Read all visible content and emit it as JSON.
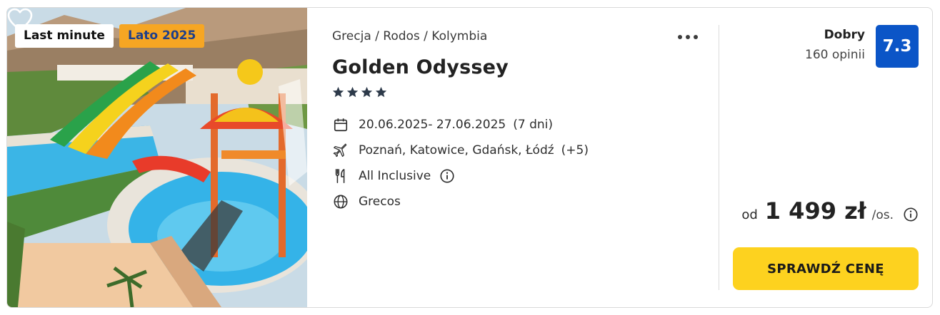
{
  "photo": {
    "alt_icon": "waterpark-photo",
    "badges": {
      "last_minute": "Last minute",
      "season": "Lato 2025"
    },
    "favorite_icon": "heart-outline-icon"
  },
  "offer": {
    "breadcrumb": "Grecja / Rodos / Kolymbia",
    "more_icon": "more-dots-icon",
    "hotel_name": "Golden Odyssey",
    "stars": 4,
    "dates": "20.06.2025- 27.06.2025",
    "duration": "(7 dni)",
    "departures": "Poznań, Katowice, Gdańsk, Łódź",
    "departures_more": "(+5)",
    "board": "All Inclusive",
    "operator": "Grecos"
  },
  "rating": {
    "label": "Dobry",
    "reviews": "160 opinii",
    "score": "7.3",
    "color": "#0b55c7"
  },
  "price": {
    "prefix": "od",
    "value": "1 499 zł",
    "suffix": "/os."
  },
  "cta": {
    "label": "SPRAWDŹ CENĘ",
    "color": "#fdd21f"
  },
  "colors": {
    "season_badge": "#f6a623",
    "season_text": "#1e3f8a"
  }
}
